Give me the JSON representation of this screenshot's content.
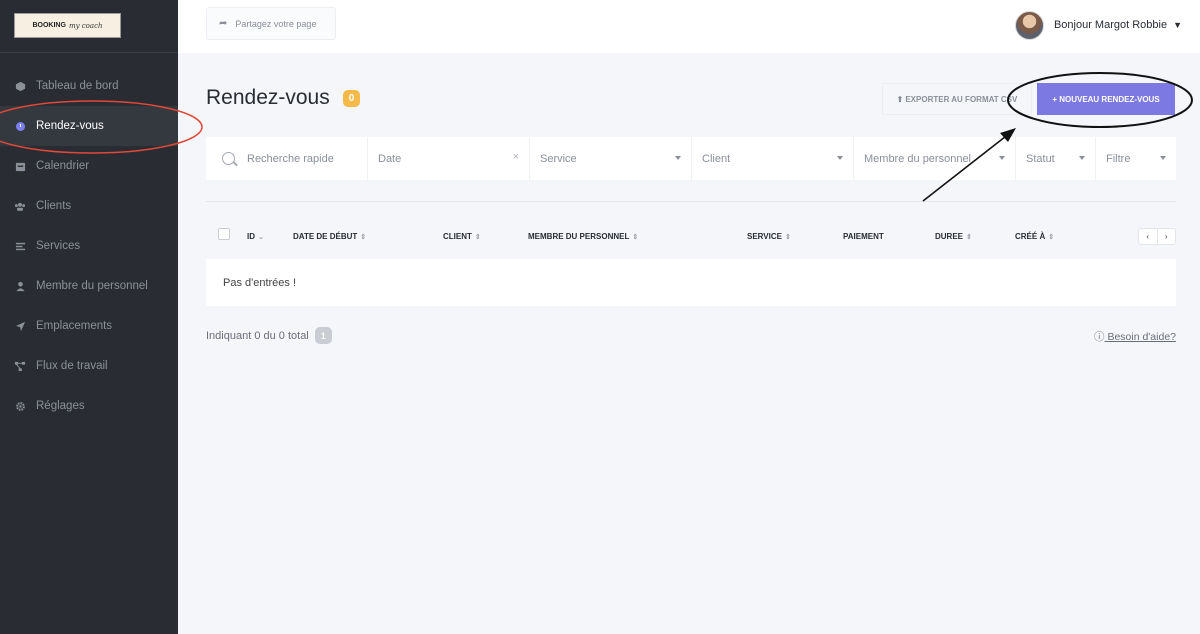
{
  "logo": {
    "line1": "BOOKING",
    "line2": "my coach"
  },
  "sidebar": {
    "items": [
      {
        "label": "Tableau de bord",
        "icon": "box-icon"
      },
      {
        "label": "Rendez-vous",
        "icon": "clock-icon",
        "active": true
      },
      {
        "label": "Calendrier",
        "icon": "calendar-icon"
      },
      {
        "label": "Clients",
        "icon": "users-icon"
      },
      {
        "label": "Services",
        "icon": "list-icon"
      },
      {
        "label": "Membre du personnel",
        "icon": "user-icon"
      },
      {
        "label": "Emplacements",
        "icon": "location-arrow-icon"
      },
      {
        "label": "Flux de travail",
        "icon": "workflow-icon"
      },
      {
        "label": "Réglages",
        "icon": "gear-icon"
      }
    ]
  },
  "topbar": {
    "share_label": "Partagez votre page",
    "greeting": "Bonjour Margot Robbie"
  },
  "page": {
    "title": "Rendez-vous",
    "count": "0",
    "export_label": "EXPORTER AU FORMAT CSV",
    "new_label": "+ NOUVEAU RENDEZ-VOUS"
  },
  "filters": {
    "search_placeholder": "Recherche rapide",
    "date": "Date",
    "service": "Service",
    "client": "Client",
    "staff": "Membre du personnel",
    "status": "Statut",
    "filter": "Filtre"
  },
  "table": {
    "columns": [
      "ID",
      "DATE DE DÉBUT",
      "CLIENT",
      "MEMBRE DU PERSONNEL",
      "SERVICE",
      "PAIEMENT",
      "DUREE",
      "CRÉÉ À"
    ],
    "empty_text": "Pas d'entrées !"
  },
  "footer": {
    "info": "Indiquant 0 du 0 total",
    "page": "1",
    "help": "Besoin d'aide?"
  },
  "colors": {
    "sidebar_bg": "#292c33",
    "accent": "#7c79e2",
    "badge": "#f5b94a",
    "annotation_red": "#e0483a"
  }
}
